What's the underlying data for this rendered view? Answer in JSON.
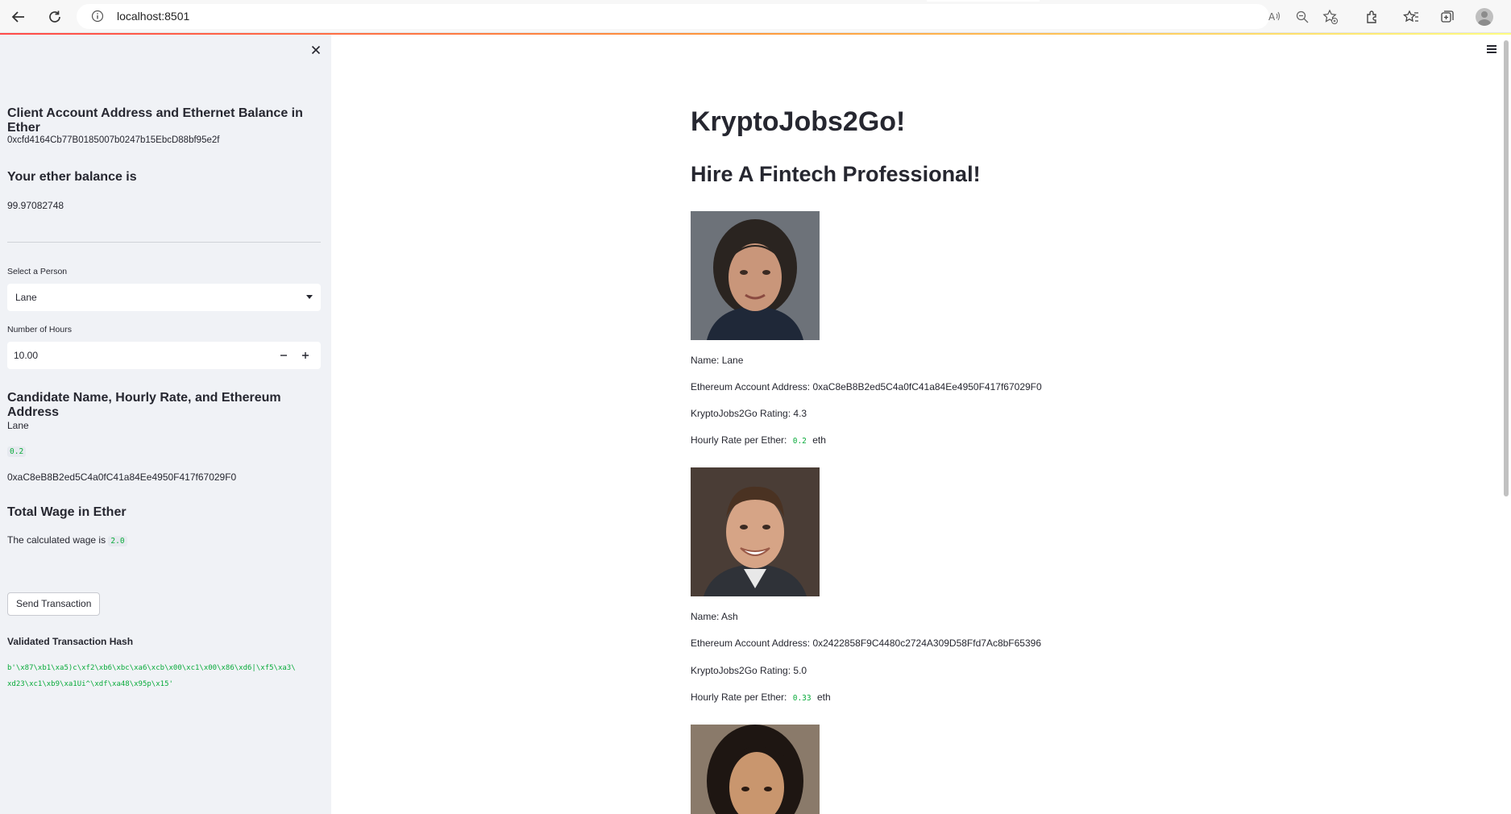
{
  "browser": {
    "url": "localhost:8501"
  },
  "sidebar": {
    "account_heading": "Client Account Address and Ethernet Balance in Ether",
    "account_address": "0xcfd4164Cb77B0185007b0247b15EbcD88bf95e2f",
    "balance_heading": "Your ether balance is",
    "balance_value": "99.97082748",
    "select_label": "Select a Person",
    "select_value": "Lane",
    "hours_label": "Number of Hours",
    "hours_value": "10.00",
    "candidate_heading": "Candidate Name, Hourly Rate, and Ethereum Address",
    "candidate_name": "Lane",
    "candidate_rate": "0.2",
    "candidate_address": "0xaC8eB8B2ed5C4a0fC41a84Ee4950F417f67029F0",
    "wage_heading": "Total Wage in Ether",
    "wage_prefix": "The calculated wage is",
    "wage_value": "2.0",
    "send_button": "Send Transaction",
    "hash_heading": "Validated Transaction Hash",
    "hash_line1": "b'\\x87\\xb1\\xa5)c\\xf2\\xb6\\xbc\\xa6\\xcb\\x00\\xc1\\x00\\x86\\xd6|\\xf5\\xa3\\",
    "hash_line2": "xd23\\xc1\\xb9\\xa1Ui^\\xdf\\xa48\\x95p\\x15'"
  },
  "main": {
    "title": "KryptoJobs2Go!",
    "subtitle": "Hire A Fintech Professional!",
    "labels": {
      "name": "Name:",
      "address": "Ethereum Account Address:",
      "rating": "KryptoJobs2Go Rating:",
      "rate": "Hourly Rate per Ether:",
      "unit": "eth"
    },
    "candidates": [
      {
        "name": "Lane",
        "address": "0xaC8eB8B2ed5C4a0fC41a84Ee4950F417f67029F0",
        "rating": "4.3",
        "rate": "0.2"
      },
      {
        "name": "Ash",
        "address": "0x2422858F9C4480c2724A309D58Ffd7Ac8bF65396",
        "rating": "5.0",
        "rate": "0.33"
      },
      {
        "name": ""
      }
    ]
  },
  "icons": {
    "back": "arrow-left-icon",
    "refresh": "refresh-icon",
    "info": "info-icon",
    "close": "close-icon",
    "menu": "hamburger-menu-icon"
  },
  "colors": {
    "sidebar_bg": "#f0f2f6",
    "code_green": "#09ab3b",
    "text": "#262730"
  }
}
